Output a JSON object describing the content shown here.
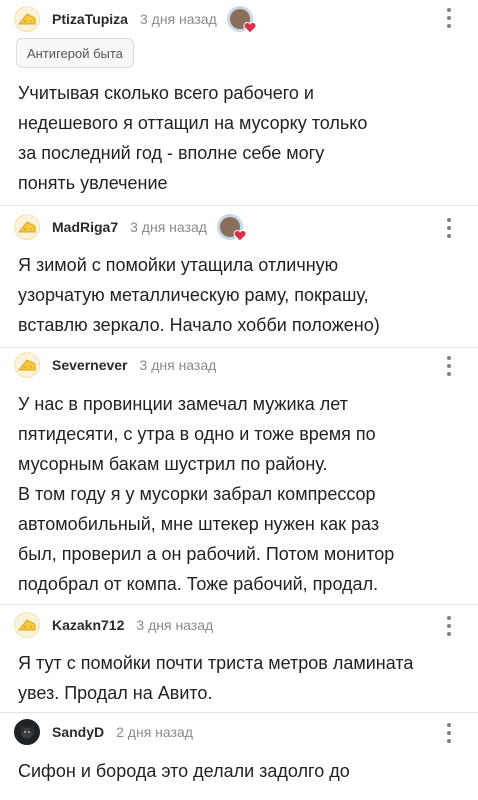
{
  "comments": [
    {
      "username": "PtizaTupiza",
      "time": "3 дня назад",
      "has_badge_avatar": true,
      "tag": "Антигерой быта",
      "text": "Учитывая сколько всего рабочего и\nнедешевого я оттащил на мусорку только\nза последний год - вполне себе могу\nпонять увлечение",
      "avatar_icon": "cheese-icon"
    },
    {
      "username": "MadRiga7",
      "time": "3 дня назад",
      "has_badge_avatar": true,
      "text": "Я зимой с помойки утащила отличную\nузорчатую металлическую раму, покрашу,\nвставлю зеркало. Начало хобби положено)",
      "avatar_icon": "cheese-icon"
    },
    {
      "username": "Severnever",
      "time": "3 дня назад",
      "text": "У нас в провинции замечал мужика лет\nпятидесяти, с утра в одно и тоже время по\nмусорным бакам шустрил по району.\nВ том году я у мусорки забрал компрессор\nавтомобильный, мне штекер нужен как раз\nбыл, проверил а он рабочий. Потом монитор\nподобрал от компа. Тоже рабочий, продал.",
      "avatar_icon": "cheese-icon"
    },
    {
      "username": "Kazakn712",
      "time": "3 дня назад",
      "text": "Я тут с помойки почти триста метров ламината\nувез. Продал на Авито.",
      "avatar_icon": "cheese-icon"
    },
    {
      "username": "SandyD",
      "time": "2 дня назад",
      "text": "Сифон и борода это делали задолго до",
      "avatar_icon": "dog-icon"
    }
  ],
  "colors": {
    "username": "#2b2b2b",
    "time": "#8a8a8a",
    "text": "#222222",
    "heart": "#d9304a"
  }
}
